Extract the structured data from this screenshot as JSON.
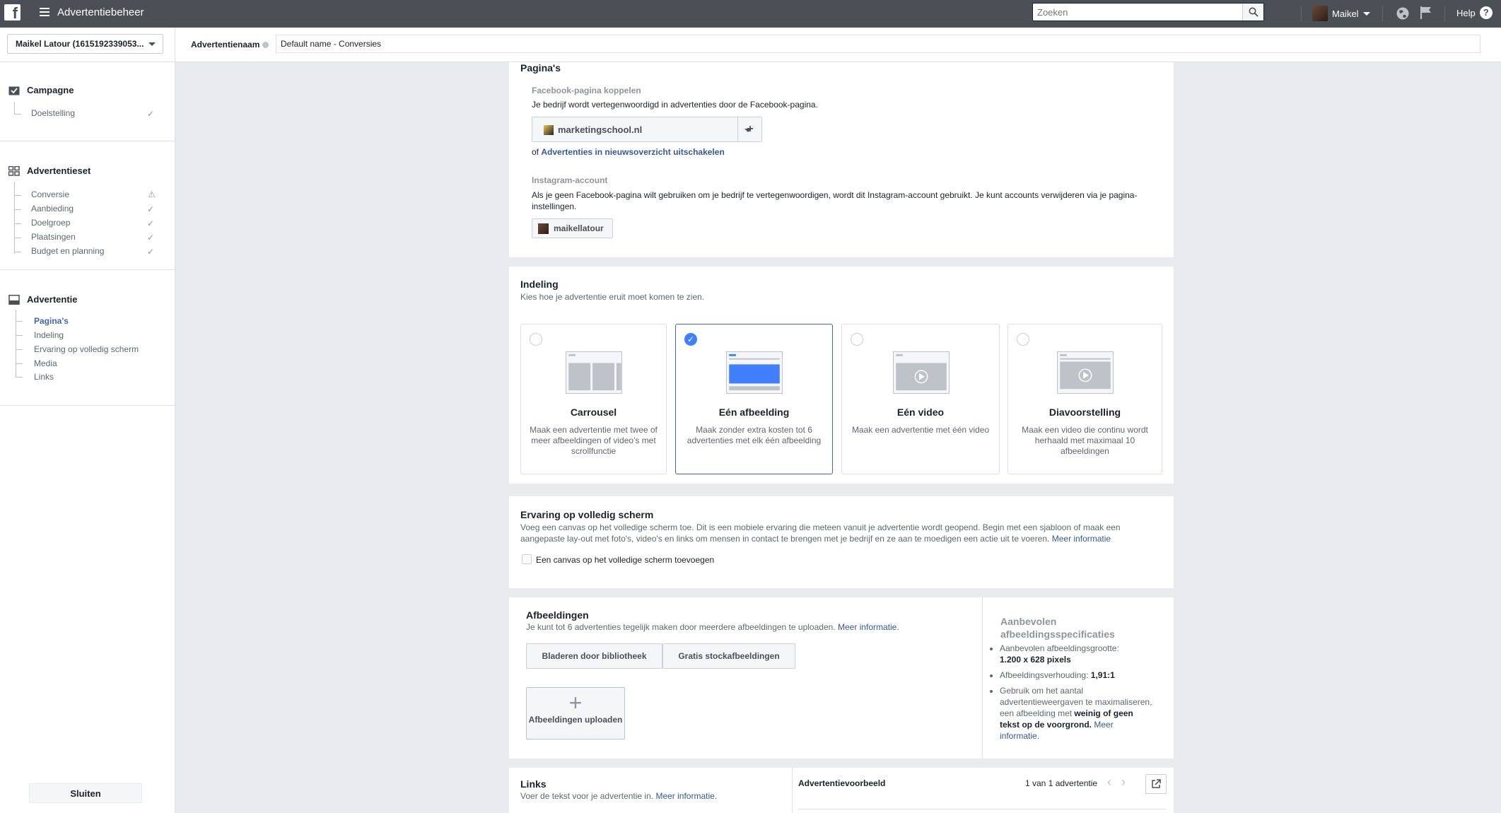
{
  "topbar": {
    "logo": "f",
    "app_title": "Advertentiebeheer",
    "search_placeholder": "Zoeken",
    "user_name": "Maikel",
    "help": "Help",
    "help_glyph": "?"
  },
  "namebar": {
    "account": "Maikel Latour (1615192339053...",
    "name_label": "Advertentienaam",
    "name_value": "Default name - Conversies"
  },
  "sidebar": {
    "campaign": {
      "title": "Campagne",
      "items": [
        {
          "label": "Doelstelling"
        }
      ]
    },
    "adset": {
      "title": "Advertentieset",
      "items": [
        {
          "label": "Conversie"
        },
        {
          "label": "Aanbieding"
        },
        {
          "label": "Doelgroep"
        },
        {
          "label": "Plaatsingen"
        },
        {
          "label": "Budget en planning"
        }
      ]
    },
    "ad": {
      "title": "Advertentie",
      "items": [
        {
          "label": "Pagina's"
        },
        {
          "label": "Indeling"
        },
        {
          "label": "Ervaring op volledig scherm"
        },
        {
          "label": "Media"
        },
        {
          "label": "Links"
        }
      ]
    },
    "close_label": "Sluiten"
  },
  "pages_section": {
    "title": "Pagina's",
    "fb_head": "Facebook-pagina koppelen",
    "fb_desc": "Je bedrijf wordt vertegenwoordigd in advertenties door de Facebook-pagina.",
    "page_selected": "marketingschool.nl",
    "add_glyph": "+",
    "or_text": "of",
    "disable_link": "Advertenties in nieuwsoverzicht uitschakelen",
    "ig_head": "Instagram-account",
    "ig_desc": "Als je geen Facebook-pagina wilt gebruiken om je bedrijf te vertegenwoordigen, wordt dit Instagram-account gebruikt. Je kunt accounts verwijderen via je pagina-instellingen.",
    "ig_account": "maikellatour"
  },
  "format_section": {
    "title": "Indeling",
    "subtitle": "Kies hoe je advertentie eruit moet komen te zien.",
    "check_glyph": "✓",
    "options": [
      {
        "title": "Carrousel",
        "desc": "Maak een advertentie met twee of meer afbeeldingen of video's met scrollfunctie"
      },
      {
        "title": "Eén afbeelding",
        "desc": "Maak zonder extra kosten tot 6 advertenties met elk één afbeelding"
      },
      {
        "title": "Eén video",
        "desc": "Maak een advertentie met één video"
      },
      {
        "title": "Diavoorstelling",
        "desc": "Maak een video die continu wordt herhaald met maximaal 10 afbeeldingen"
      }
    ]
  },
  "fullscreen_section": {
    "title": "Ervaring op volledig scherm",
    "desc": "Voeg een canvas op het volledige scherm toe. Dit is een mobiele ervaring die meteen vanuit je advertentie wordt geopend. Begin met een sjabloon of maak een aangepaste lay-out met foto's, video's en links om mensen in contact te brengen met je bedrijf en ze aan te moedigen een actie uit te voeren.",
    "more_link": "Meer informatie",
    "checkbox_label": "Een canvas op het volledige scherm toevoegen"
  },
  "images_section": {
    "title": "Afbeeldingen",
    "desc": "Je kunt tot 6 advertenties tegelijk maken door meerdere afbeeldingen te uploaden.",
    "more_link": "Meer informatie.",
    "browse_btn": "Bladeren door bibliotheek",
    "stock_btn": "Gratis stockafbeeldingen",
    "upload_glyph": "+",
    "upload_btn": "Afbeeldingen uploaden",
    "specs_title": "Aanbevolen afbeeldingsspecificaties",
    "spec1_label": "Aanbevolen afbeeldingsgrootte:",
    "spec1_value": "1.200 x 628 pixels",
    "spec2_label": "Afbeeldingsverhouding:",
    "spec2_value": "1,91:1",
    "spec3_pre": "Gebruik om het aantal advertentieweergaven te maximaliseren, een afbeelding met",
    "spec3_bold": "weinig of geen tekst op de voorgrond.",
    "spec3_link": "Meer informatie."
  },
  "links_section": {
    "title": "Links",
    "desc": "Voer de tekst voor je advertentie in.",
    "more_link": "Meer informatie.",
    "preview_title": "Advertentievoorbeeld",
    "preview_count": "1 van 1 advertentie",
    "prev_glyph": "‹",
    "next_glyph": "›"
  },
  "colors": {
    "topbar": "#4b4f56",
    "link": "#365899",
    "accent": "#4080ff",
    "background": "#e9ebee"
  }
}
